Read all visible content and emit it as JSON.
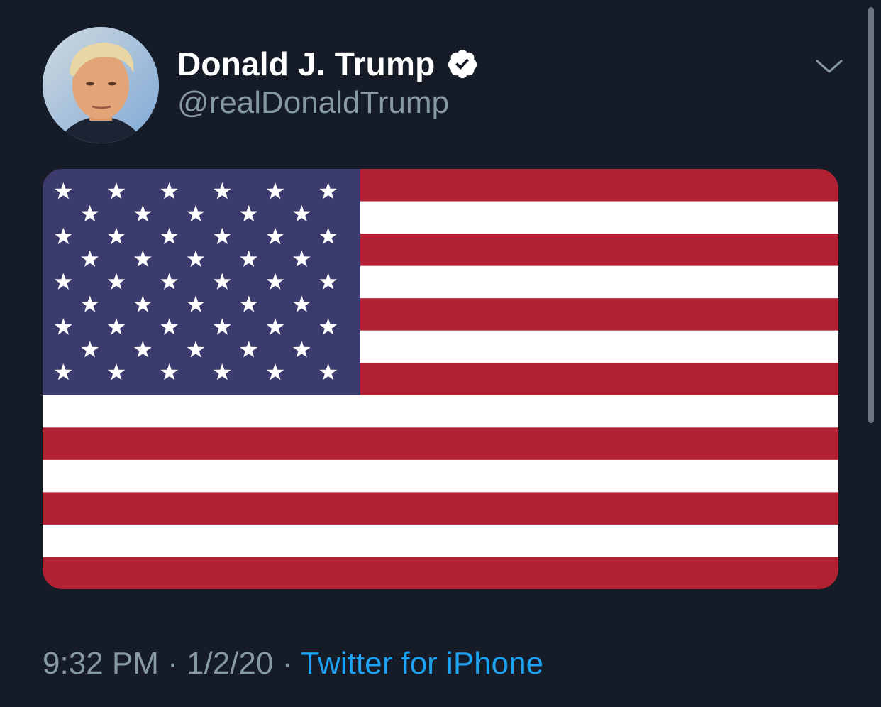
{
  "tweet": {
    "display_name": "Donald J. Trump",
    "handle": "@realDonaldTrump",
    "verified": true,
    "time": "9:32 PM",
    "separator": "·",
    "date": "1/2/20",
    "source": "Twitter for iPhone"
  },
  "icons": {
    "verified": "verified-badge-icon",
    "menu": "chevron-down-icon"
  },
  "media": {
    "description_icon": "us-flag-image",
    "colors": {
      "red": "#b22234",
      "white": "#ffffff",
      "blue": "#3c3b6e"
    }
  },
  "colors": {
    "background": "#151c28",
    "text_primary": "#ffffff",
    "text_secondary": "#8899a6",
    "link": "#1da1f2"
  }
}
